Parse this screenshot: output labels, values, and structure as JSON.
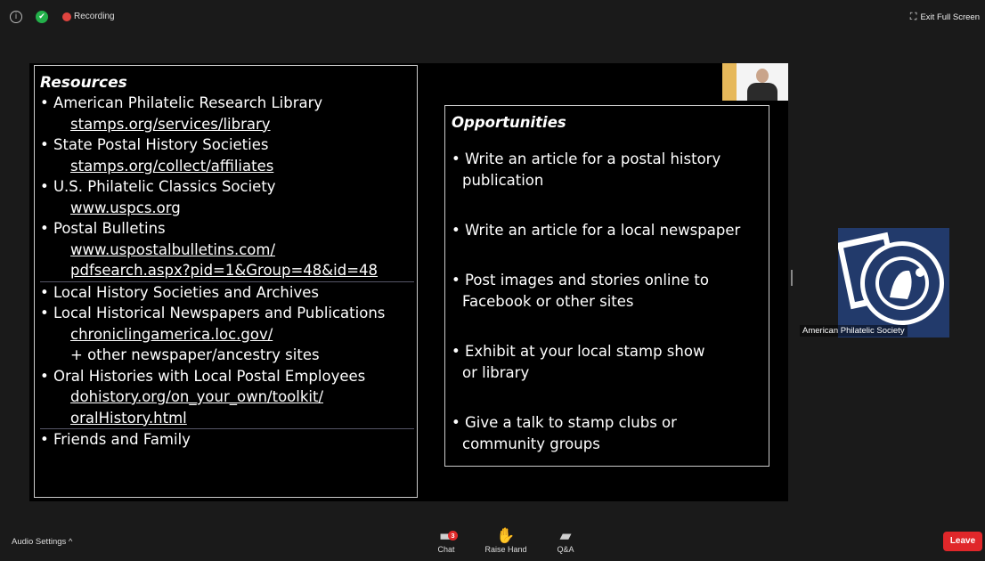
{
  "topbar": {
    "info_icon": "i",
    "shield_icon": "✔",
    "recording_label": "Recording",
    "exit_icon": "⛶",
    "exit_label": "Exit Full Screen"
  },
  "resources": {
    "title": "Resources",
    "items": [
      "• American Philatelic Research Library",
      "stamps.org/services/library",
      "• State Postal History Societies",
      "stamps.org/collect/affiliates",
      "• U.S. Philatelic Classics Society",
      "www.uspcs.org",
      "• Postal Bulletins",
      "www.uspostalbulletins.com/",
      "pdfsearch.aspx?pid=1&Group=48&id=48",
      "• Local History Societies and Archives",
      "• Local Historical Newspapers and Publications",
      "chroniclingamerica.loc.gov/",
      "+ other newspaper/ancestry sites",
      "• Oral Histories with Local Postal Employees",
      "dohistory.org/on_your_own/toolkit/",
      "oralHistory.html",
      "• Friends and Family"
    ]
  },
  "opportunities": {
    "title": "Opportunities",
    "items": [
      {
        "line1": "• Write an article for a postal history",
        "line2": "publication"
      },
      {
        "line1": "• Write an article for a local newspaper",
        "line2": ""
      },
      {
        "line1": "• Post images and stories online to",
        "line2": "Facebook or other sites"
      },
      {
        "line1": "• Exhibit at your local stamp show",
        "line2": "or library"
      },
      {
        "line1": "• Give a talk to stamp clubs or",
        "line2": "community groups"
      }
    ]
  },
  "participant": {
    "name": "American Philatelic Society",
    "logo_icon": "aps-stamp-logo"
  },
  "bottombar": {
    "audio_label": "Audio Settings",
    "audio_chevron": "^",
    "chat_label": "Chat",
    "chat_badge": "3",
    "raise_label": "Raise Hand",
    "qa_label": "Q&A",
    "leave_label": "Leave"
  },
  "colors": {
    "leave": "#e0272a",
    "recording": "#e0443f",
    "shield": "#23b04a",
    "logo_bg": "#223a6b"
  }
}
